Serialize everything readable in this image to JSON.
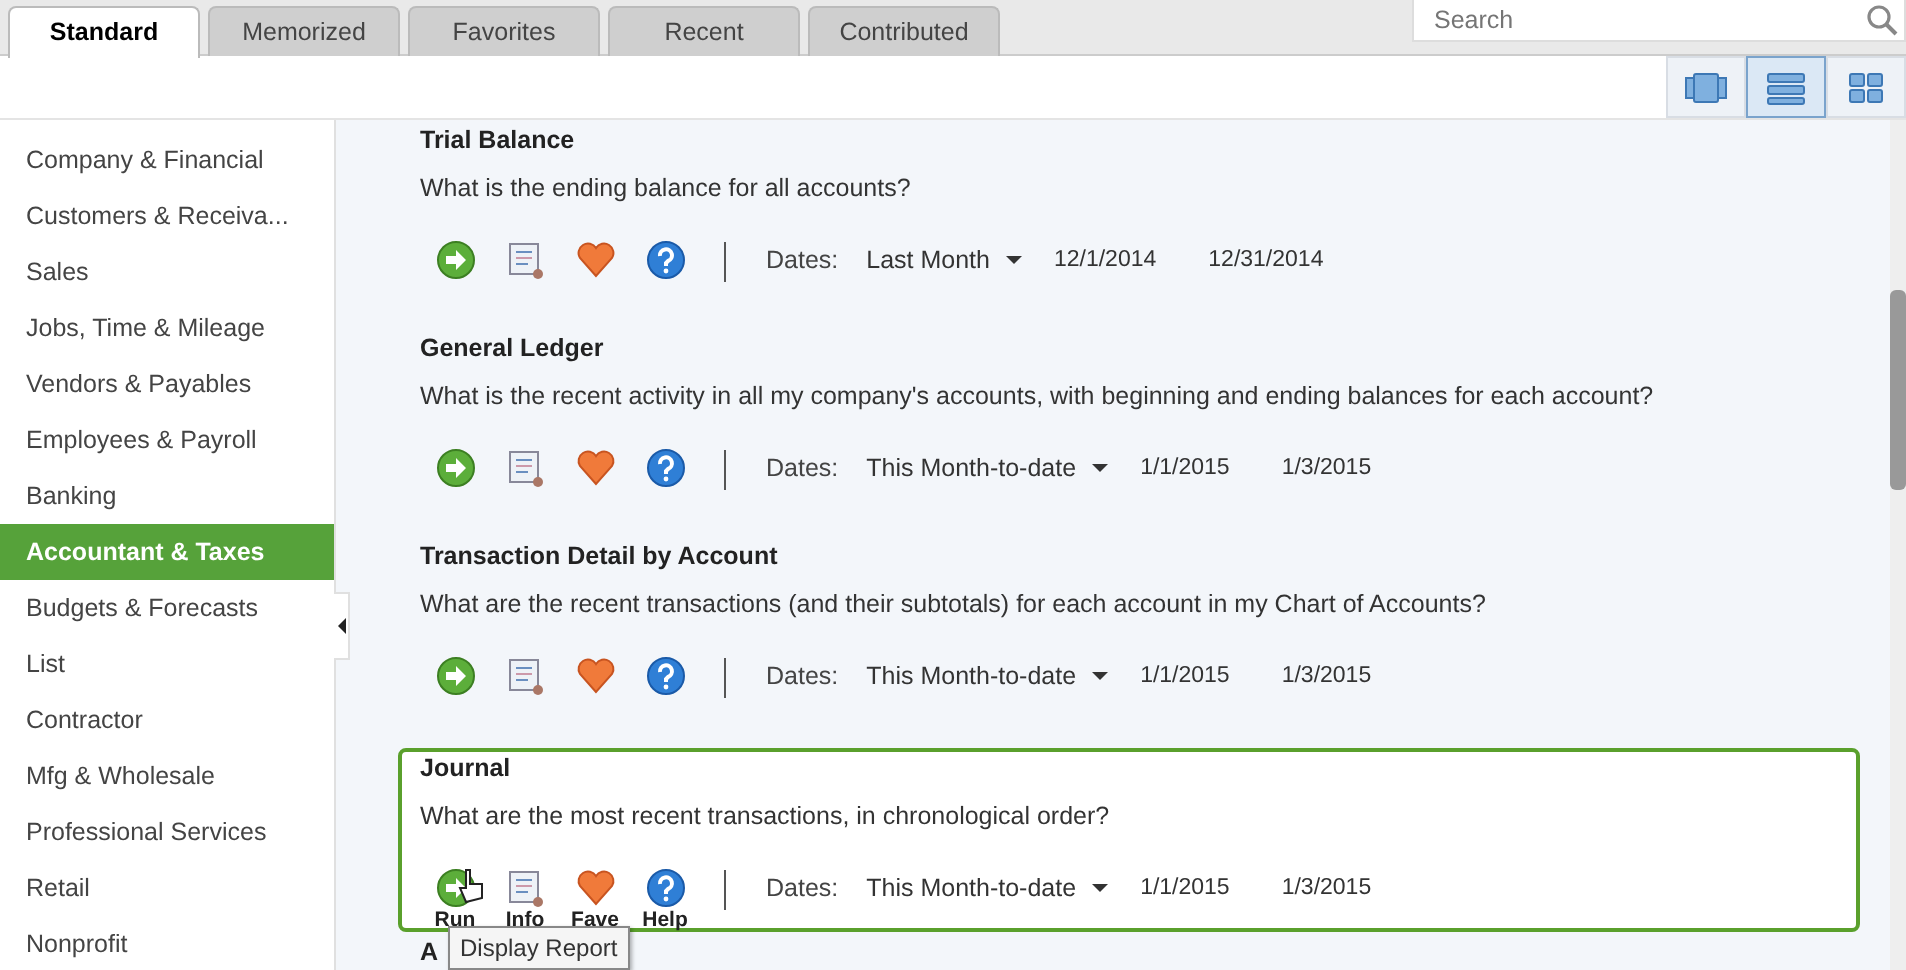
{
  "tabs": [
    {
      "label": "Standard",
      "selected": true
    },
    {
      "label": "Memorized",
      "selected": false
    },
    {
      "label": "Favorites",
      "selected": false
    },
    {
      "label": "Recent",
      "selected": false
    },
    {
      "label": "Contributed",
      "selected": false
    }
  ],
  "search": {
    "placeholder": "Search"
  },
  "view_buttons": [
    {
      "kind": "carousel",
      "selected": false
    },
    {
      "kind": "list",
      "selected": true
    },
    {
      "kind": "grid",
      "selected": false
    }
  ],
  "sidebar": {
    "items": [
      {
        "label": "Company & Financial",
        "selected": false
      },
      {
        "label": "Customers & Receiva...",
        "selected": false
      },
      {
        "label": "Sales",
        "selected": false
      },
      {
        "label": "Jobs, Time & Mileage",
        "selected": false
      },
      {
        "label": "Vendors & Payables",
        "selected": false
      },
      {
        "label": "Employees & Payroll",
        "selected": false
      },
      {
        "label": "Banking",
        "selected": false
      },
      {
        "label": "Accountant & Taxes",
        "selected": true
      },
      {
        "label": "Budgets & Forecasts",
        "selected": false
      },
      {
        "label": "List",
        "selected": false
      },
      {
        "label": "Contractor",
        "selected": false
      },
      {
        "label": "Mfg & Wholesale",
        "selected": false
      },
      {
        "label": "Professional Services",
        "selected": false
      },
      {
        "label": "Retail",
        "selected": false
      },
      {
        "label": "Nonprofit",
        "selected": false
      }
    ]
  },
  "reports": [
    {
      "title": "Trial Balance",
      "question": "What is the ending balance for all accounts?",
      "dates_label": "Dates:",
      "period": "Last Month",
      "from": "12/1/2014",
      "to": "12/31/2014",
      "selected": false
    },
    {
      "title": "General Ledger",
      "question": "What is the recent activity in all my company's accounts, with beginning and ending balances for each account?",
      "dates_label": "Dates:",
      "period": "This Month-to-date",
      "from": "1/1/2015",
      "to": "1/3/2015",
      "selected": false
    },
    {
      "title": "Transaction Detail by Account",
      "question": "What are the recent transactions (and their subtotals) for each account in my Chart of Accounts?",
      "dates_label": "Dates:",
      "period": "This Month-to-date",
      "from": "1/1/2015",
      "to": "1/3/2015",
      "selected": false
    },
    {
      "title": "Journal",
      "question": "What are the most recent transactions, in chronological order?",
      "dates_label": "Dates:",
      "period": "This Month-to-date",
      "from": "1/1/2015",
      "to": "1/3/2015",
      "selected": true,
      "action_labels": [
        "Run",
        "Info",
        "Fave",
        "Help"
      ]
    },
    {
      "title": "A",
      "selected": false
    }
  ],
  "tooltip": "Display Report"
}
